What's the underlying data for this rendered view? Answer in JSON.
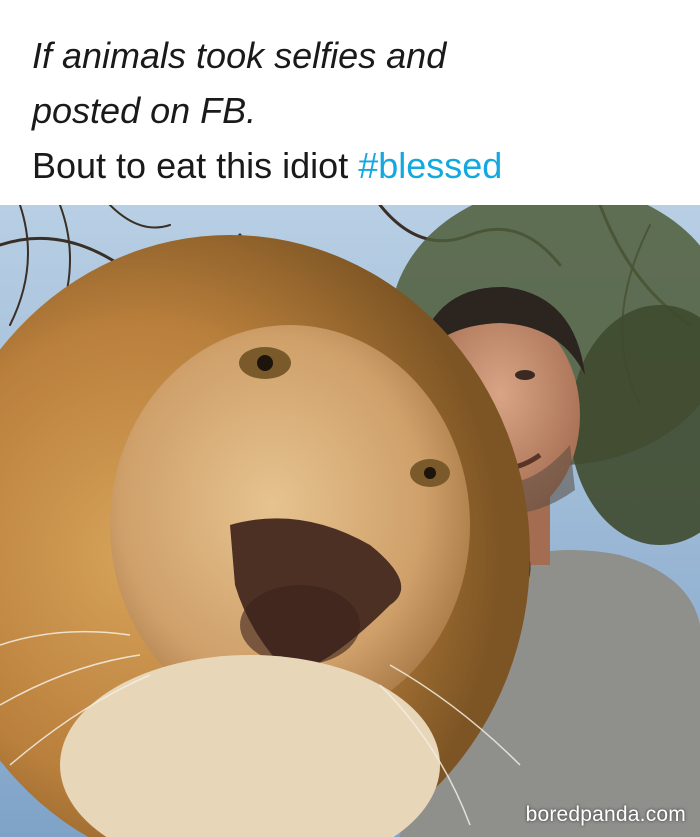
{
  "caption": {
    "line1": "If animals took selfies and",
    "line2": "posted on FB.",
    "line3_text": "Bout to eat this idiot ",
    "line3_hashtag": "#blessed"
  },
  "photo": {
    "subjects": [
      "lion",
      "man"
    ],
    "watermark": "boredpanda.com"
  },
  "colors": {
    "text": "#1a1a1a",
    "hashtag": "#14a8e0",
    "background": "#ffffff"
  }
}
